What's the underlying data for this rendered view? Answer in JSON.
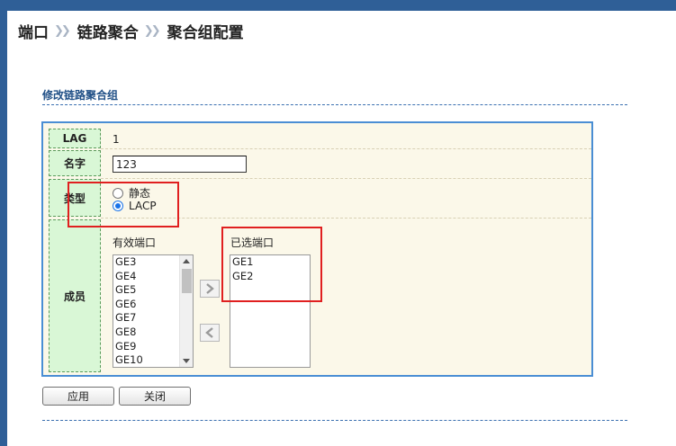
{
  "breadcrumb": {
    "items": [
      "端口",
      "链路聚合",
      "聚合组配置"
    ],
    "separator": "》"
  },
  "section": {
    "title": "修改链路聚合组"
  },
  "form": {
    "lag": {
      "label": "LAG",
      "value": "1"
    },
    "name": {
      "label": "名字",
      "value": "123"
    },
    "type": {
      "label": "类型",
      "options": [
        {
          "label": "静态",
          "checked": false
        },
        {
          "label": "LACP",
          "checked": true
        }
      ]
    },
    "members": {
      "label": "成员",
      "available_label": "有效端口",
      "available": [
        "GE3",
        "GE4",
        "GE5",
        "GE6",
        "GE7",
        "GE8",
        "GE9",
        "GE10"
      ],
      "selected_label": "已选端口",
      "selected": [
        "GE1",
        "GE2"
      ]
    }
  },
  "buttons": {
    "apply": "应用",
    "close": "关闭"
  },
  "colors": {
    "accent": "#2f5f97",
    "label_bg": "#d9f7d6",
    "form_bg": "#fbf8e9",
    "highlight": "#e02020"
  }
}
